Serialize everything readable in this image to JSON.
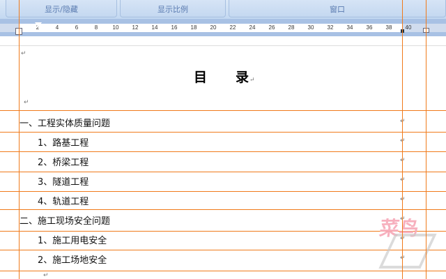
{
  "ribbon": {
    "groups": [
      "显示/隐藏",
      "显示比例",
      "窗口"
    ]
  },
  "ruler": {
    "ticks": [
      "2",
      "4",
      "6",
      "8",
      "10",
      "12",
      "14",
      "16",
      "18",
      "20",
      "22",
      "24",
      "26",
      "28",
      "30",
      "32",
      "34",
      "36",
      "38",
      "40"
    ]
  },
  "document": {
    "title_a": "目",
    "title_b": "录",
    "paragraph_mark": "↵",
    "toc": [
      {
        "text": "一、工程实体质量问题",
        "level": 1
      },
      {
        "text": "1、路基工程",
        "level": 2
      },
      {
        "text": "2、桥梁工程",
        "level": 2
      },
      {
        "text": "3、隧道工程",
        "level": 2
      },
      {
        "text": "4、轨道工程",
        "level": 2
      },
      {
        "text": "二、施工现场安全问题",
        "level": 1
      },
      {
        "text": "1、施工用电安全",
        "level": 2
      },
      {
        "text": "2、施工场地安全",
        "level": 2
      }
    ]
  },
  "watermark": {
    "text": "菜鸟"
  }
}
